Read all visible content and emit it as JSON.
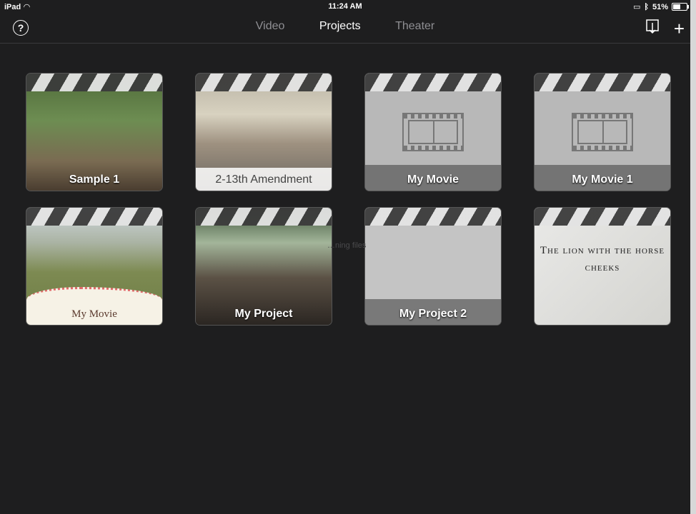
{
  "status": {
    "device": "iPad",
    "time": "11:24 AM",
    "battery": "51%",
    "battery_level": 0.51
  },
  "nav": {
    "tabs": [
      {
        "label": "Video",
        "active": false
      },
      {
        "label": "Projects",
        "active": true
      },
      {
        "label": "Theater",
        "active": false
      }
    ]
  },
  "projects": [
    {
      "label": "Sample 1"
    },
    {
      "label": "2-13th Amendment"
    },
    {
      "label": "My Movie"
    },
    {
      "label": "My Movie 1"
    },
    {
      "label": "My Movie"
    },
    {
      "label": "My Project"
    },
    {
      "label": "My Project 2"
    },
    {
      "label": "The lion with the horse cheeks"
    }
  ],
  "ghost_text": "…ning files",
  "colors": {
    "background": "#1e1e1f",
    "active_tab": "#ffffff",
    "inactive_tab": "#8f8f93"
  }
}
